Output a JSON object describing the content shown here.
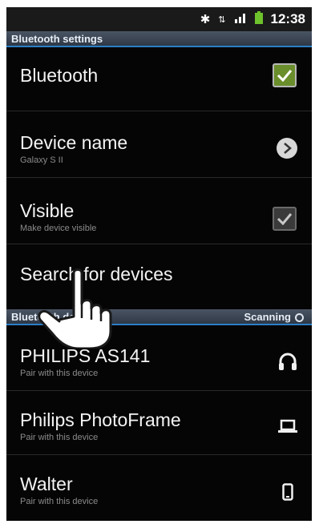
{
  "status_bar": {
    "time": "12:38"
  },
  "sections": {
    "bluetooth_settings": "Bluetooth settings",
    "bluetooth_devices": "Bluetooth devices",
    "scanning": "Scanning"
  },
  "settings": {
    "bluetooth": {
      "label": "Bluetooth",
      "checked": true
    },
    "device_name": {
      "label": "Device name",
      "value": "Galaxy S II"
    },
    "visible": {
      "label": "Visible",
      "sub": "Make device visible",
      "checked": true
    },
    "search": {
      "label": "Search for devices"
    }
  },
  "devices": [
    {
      "name": "PHILIPS AS141",
      "sub": "Pair with this device",
      "icon": "headphones-icon"
    },
    {
      "name": "Philips PhotoFrame",
      "sub": "Pair with this device",
      "icon": "laptop-icon"
    },
    {
      "name": "Walter",
      "sub": "Pair with this device",
      "icon": "phone-icon"
    }
  ],
  "colors": {
    "accent": "#2b7fc7",
    "check_on": "#6a8e2b",
    "section_bg": "#3c4757"
  }
}
